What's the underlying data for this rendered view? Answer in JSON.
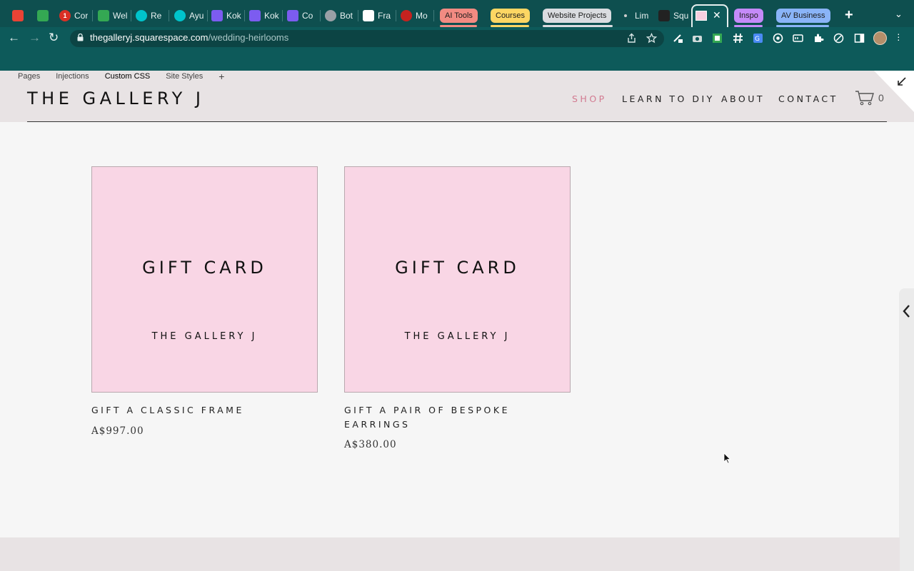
{
  "browser": {
    "tabs": [
      {
        "label": "",
        "icon": "gmail-icon",
        "color": "#ea4335"
      },
      {
        "label": "",
        "icon": "drive-icon",
        "color": "#34a853"
      },
      {
        "label": "Cor",
        "icon": "notification-icon",
        "badge": "1",
        "color": "#d93025"
      },
      {
        "label": "Wel",
        "icon": "drive-icon",
        "color": "#34a853"
      },
      {
        "label": "Re",
        "icon": "canva-icon",
        "color": "#00c4cc"
      },
      {
        "label": "Ayu",
        "icon": "canva-icon",
        "color": "#00c4cc"
      },
      {
        "label": "Kok",
        "icon": "shield-heart-icon",
        "color": "#7c5cf0"
      },
      {
        "label": "Kok",
        "icon": "shield-heart-icon",
        "color": "#7c5cf0"
      },
      {
        "label": "Co",
        "icon": "shield-heart-icon",
        "color": "#7c5cf0"
      },
      {
        "label": "Bot",
        "icon": "circle-icon",
        "color": "#9aa0a6"
      },
      {
        "label": "Fra",
        "icon": "page-icon",
        "color": "#ffffff"
      },
      {
        "label": "Mo",
        "icon": "record-icon",
        "color": "#c5221f"
      },
      {
        "label": "Lim",
        "icon": "dot-icon",
        "color": "#cccccc"
      },
      {
        "label": "Squ",
        "icon": "squarespace-icon",
        "color": "#222222"
      }
    ],
    "groups": [
      {
        "label": "AI Tools",
        "color": "#f28b82"
      },
      {
        "label": "Courses",
        "color": "#fdd663"
      },
      {
        "label": "Website Projects",
        "color": "#dadce0"
      },
      {
        "label": "Inspo",
        "color": "#c58af9"
      },
      {
        "label": "AV Business",
        "color": "#8ab4f8"
      }
    ],
    "close_symbol": "✕",
    "new_tab_symbol": "+",
    "tab_menu_symbol": "⌄",
    "url_domain": "thegalleryj.squarespace.com",
    "url_path": "/wedding-heirlooms",
    "back_symbol": "←",
    "forward_symbol": "→",
    "reload_symbol": "↻"
  },
  "site": {
    "edit_links": [
      "Pages",
      "Injections",
      "Custom CSS",
      "Site Styles",
      "+"
    ],
    "logo": "THE GALLERY J",
    "nav": {
      "shop": "SHOP",
      "learn": "LEARN TO DIY",
      "about": "ABOUT",
      "contact": "CONTACT"
    },
    "cart_count": "0",
    "accent_color": "#d27a90",
    "products": [
      {
        "image_title": "GIFT CARD",
        "image_subtitle": "THE GALLERY J",
        "name": "GIFT A CLASSIC FRAME",
        "price": "A$997.00"
      },
      {
        "image_title": "GIFT CARD",
        "image_subtitle": "THE GALLERY J",
        "name": "GIFT A PAIR OF BESPOKE EARRINGS",
        "price": "A$380.00"
      }
    ]
  }
}
